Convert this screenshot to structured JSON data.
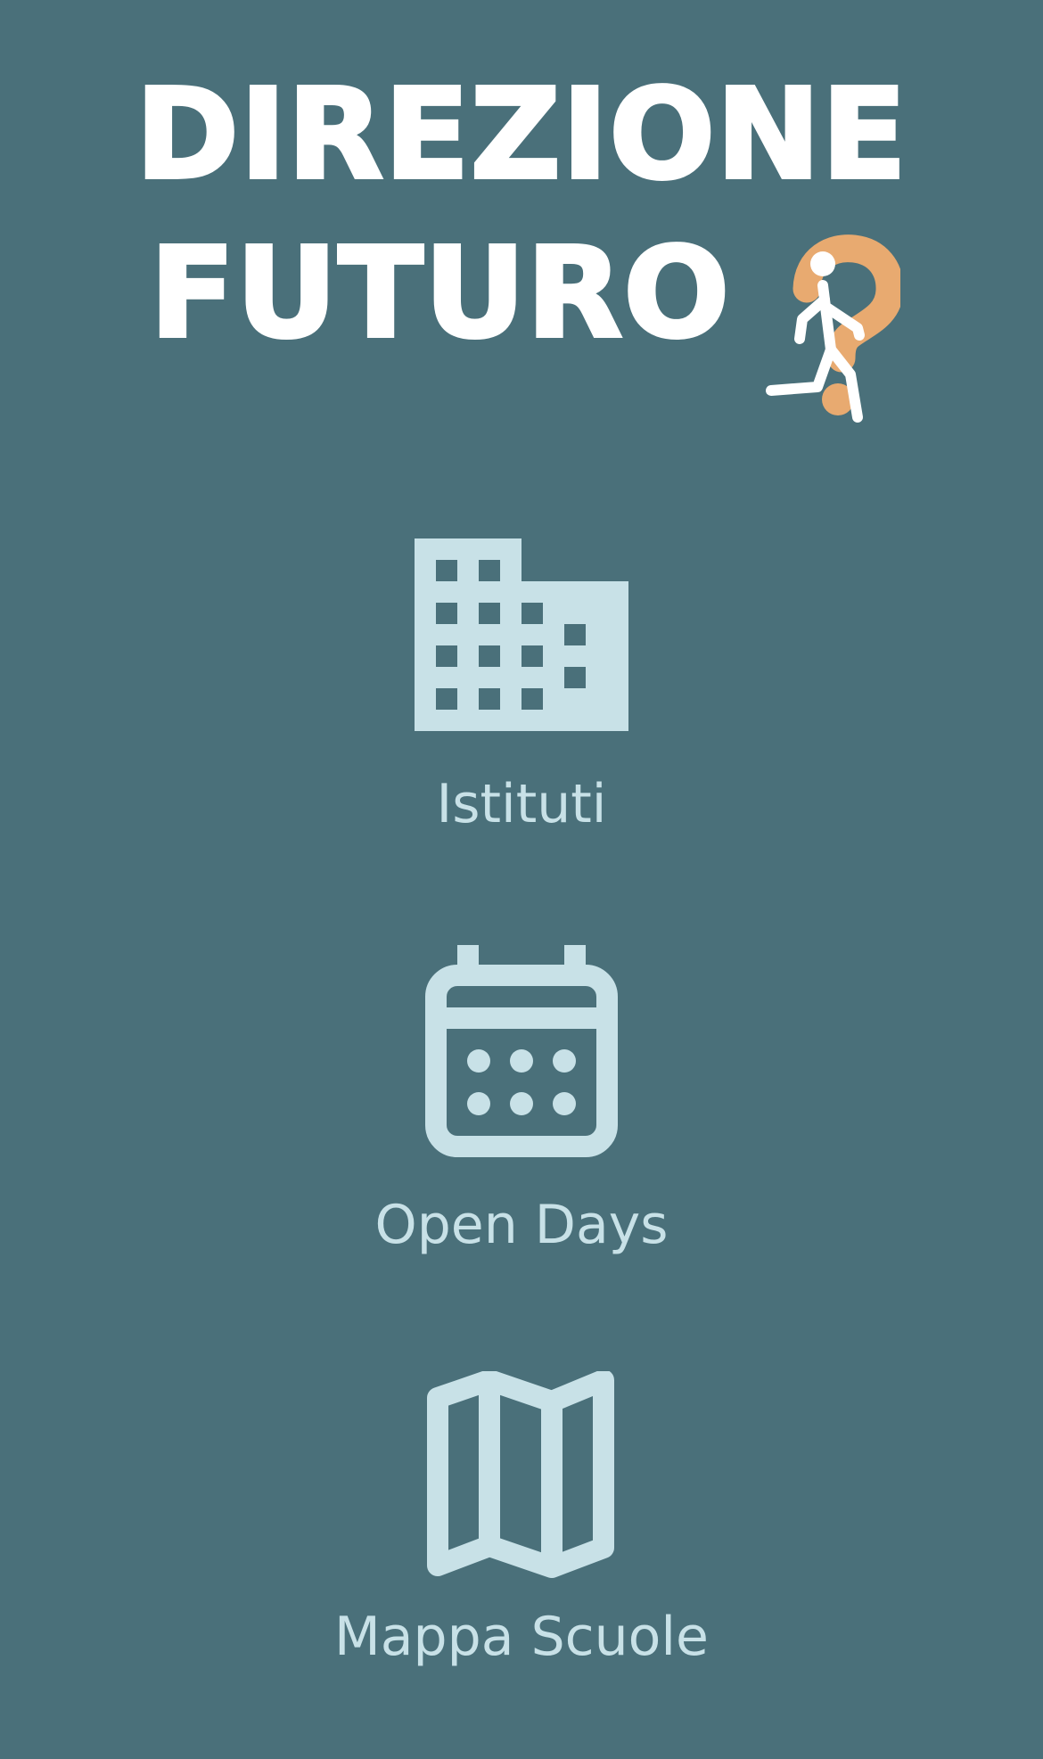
{
  "header": {
    "title_line_1": "DIREZIONE",
    "title_line_2": "FUTURO",
    "logo_icons": [
      "runner-icon",
      "question-mark-icon"
    ]
  },
  "menu": {
    "items": [
      {
        "label": "Istituti",
        "icon": "building-icon"
      },
      {
        "label": "Open Days",
        "icon": "calendar-icon"
      },
      {
        "label": "Mappa Scuole",
        "icon": "map-icon"
      }
    ]
  },
  "colors": {
    "background": "#4a707a",
    "title": "#ffffff",
    "accent": "#e8aa70",
    "icon": "#c8e1e7"
  }
}
